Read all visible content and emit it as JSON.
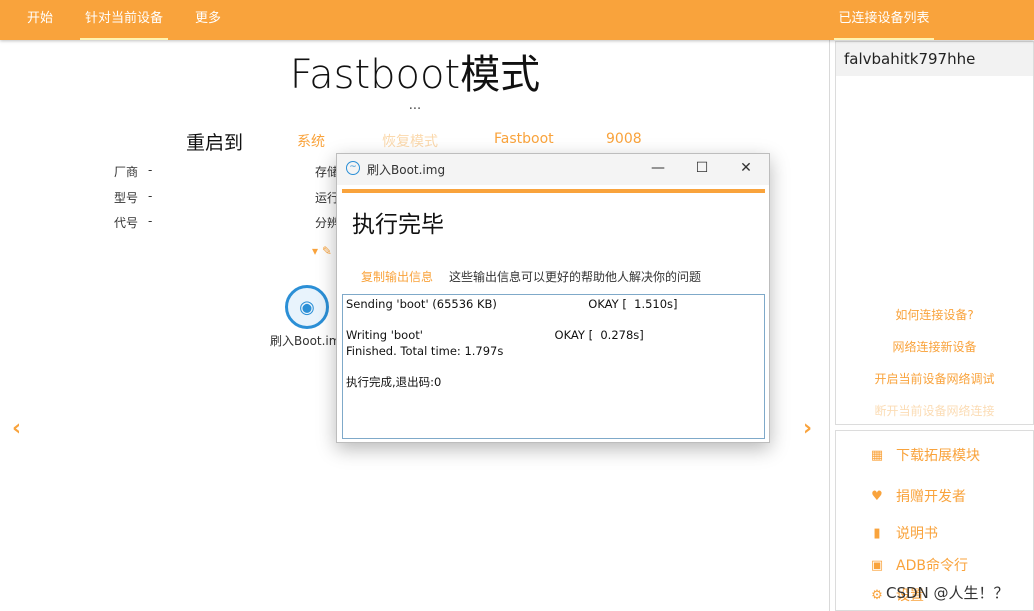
{
  "topbar": {
    "tabs": [
      "开始",
      "针对当前设备",
      "更多"
    ],
    "right_tab": "已连接设备列表"
  },
  "main": {
    "title": "Fastboot模式",
    "ellipsis": "...",
    "reboot_label": "重启到",
    "reboot_options": [
      "系统",
      "恢复模式",
      "Fastboot",
      "9008"
    ],
    "info_labels": [
      "厂商",
      "型号",
      "代号"
    ],
    "info_values": [
      "-",
      "-",
      "-"
    ],
    "info2_labels": [
      "存储",
      "运行",
      "分辨"
    ],
    "boot_label": "刷入Boot.img",
    "boot_icon": "disc-flash-icon"
  },
  "devices": {
    "items": [
      "falvbahitk797hhe"
    ],
    "links": [
      "如何连接设备?",
      "网络连接新设备",
      "开启当前设备网络调试",
      "断开当前设备网络连接"
    ]
  },
  "tools": {
    "items": [
      "下载拓展模块",
      "捐赠开发者",
      "说明书",
      "ADB命令行",
      "设置"
    ]
  },
  "dialog": {
    "title": "刷入Boot.img",
    "heading": "执行完毕",
    "copy_button": "复制输出信息",
    "copy_hint": "这些输出信息可以更好的帮助他人解决你的问题",
    "output_lines": [
      "Sending 'boot' (65536 KB)                         OKAY [  1.510s]",
      "",
      "Writing 'boot'                                    OKAY [  0.278s]",
      "Finished. Total time: 1.797s",
      "",
      "执行完成,退出码:0"
    ]
  },
  "watermark": "CSDN @人生！？",
  "colors": {
    "accent": "#f9a33c",
    "boot_icon_blue": "#2b8fd6"
  }
}
